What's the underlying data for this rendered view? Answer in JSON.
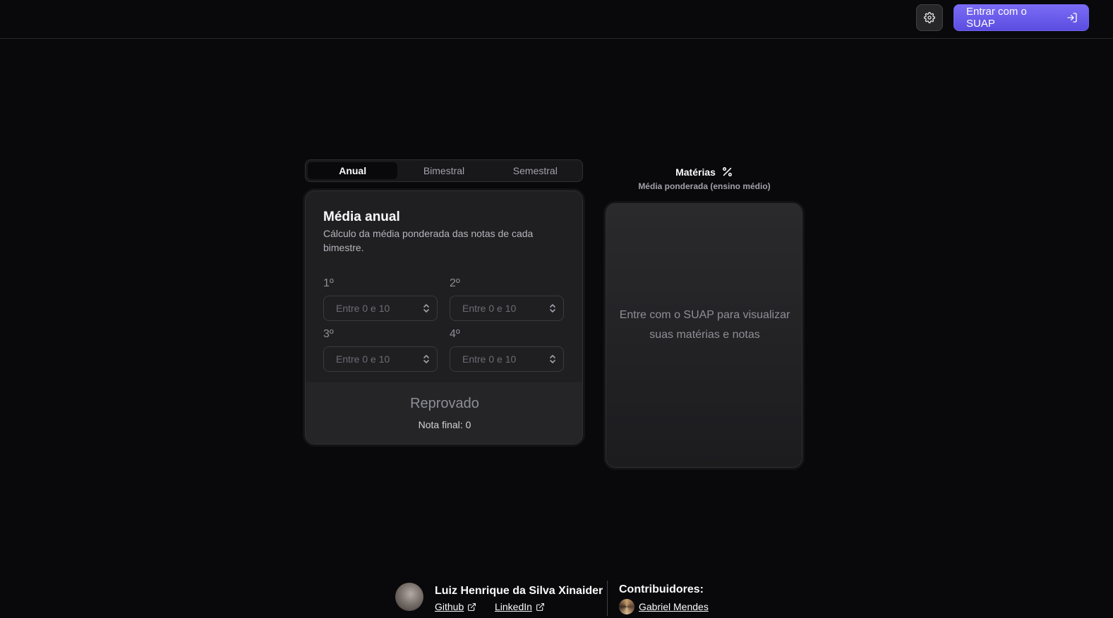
{
  "header": {
    "settings_icon": "gear-icon",
    "login_label": "Entrar com o SUAP",
    "login_icon": "log-in-icon",
    "accent_color": "#6a5ae8"
  },
  "tabs": [
    {
      "label": "Anual",
      "active": true
    },
    {
      "label": "Bimestral",
      "active": false
    },
    {
      "label": "Semestral",
      "active": false
    }
  ],
  "calculator": {
    "title": "Média anual",
    "description": "Cálculo da média ponderada das notas de cada bimestre.",
    "fields": [
      {
        "label": "1º",
        "placeholder": "Entre 0 e 10",
        "value": ""
      },
      {
        "label": "2º",
        "placeholder": "Entre 0 e 10",
        "value": ""
      },
      {
        "label": "3º",
        "placeholder": "Entre 0 e 10",
        "value": ""
      },
      {
        "label": "4º",
        "placeholder": "Entre 0 e 10",
        "value": ""
      }
    ],
    "status": "Reprovado",
    "final_grade": "Nota final: 0"
  },
  "subjects": {
    "title": "Matérias",
    "title_icon": "percent-icon",
    "subtitle": "Média ponderada (ensino médio)",
    "empty_message": "Entre com o SUAP para visualizar suas matérias e notas"
  },
  "footer": {
    "author": "Luiz Henrique da Silva Xinaider",
    "github_label": "Github",
    "linkedin_label": "LinkedIn",
    "contributors_title": "Contribuidores:",
    "contributors": [
      "Gabriel Mendes"
    ]
  }
}
